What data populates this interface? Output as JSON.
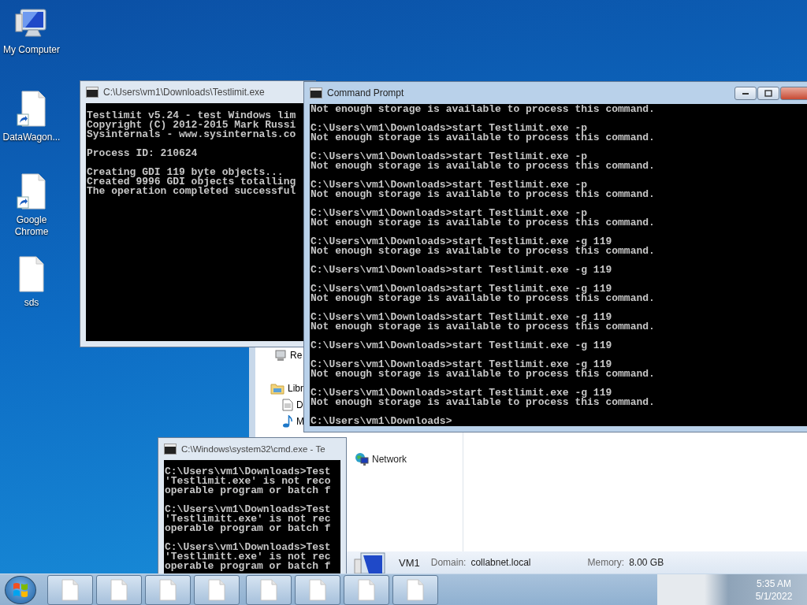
{
  "desktop_icons": [
    {
      "label": "My Computer",
      "kind": "computer"
    },
    {
      "label": "DataWagon...",
      "kind": "shortcut"
    },
    {
      "label": "Google Chrome",
      "kind": "shortcut"
    },
    {
      "label": "sds",
      "kind": "file"
    }
  ],
  "explorer_window": {
    "nav_items": [
      {
        "label": "Re",
        "kind": "device"
      },
      {
        "label": "Libr",
        "kind": "folder"
      },
      {
        "label": "D",
        "kind": "document"
      },
      {
        "label": "M",
        "kind": "music"
      },
      {
        "label": "Network",
        "kind": "network"
      }
    ],
    "details": {
      "name": "VM1",
      "fields": [
        {
          "label": "Domain:",
          "value": "collabnet.local"
        },
        {
          "label": "Memory:",
          "value": "8.00 GB"
        }
      ]
    }
  },
  "testlimit_window": {
    "title": "C:\\Users\\vm1\\Downloads\\Testlimit.exe",
    "active": false,
    "blocks": [
      [
        "Testlimit v5.24 - test Windows lim",
        "Copyright (C) 2012-2015 Mark Russi",
        "Sysinternals - www.sysinternals.co"
      ],
      [
        "Process ID: 210624"
      ],
      [
        "Creating GDI 119 byte objects...",
        "Created 9996 GDI objects totalling",
        "The operation completed successful"
      ]
    ]
  },
  "cmd_window": {
    "title": "C:\\Windows\\system32\\cmd.exe - Te",
    "active": false,
    "blocks": [
      [
        "C:\\Users\\vm1\\Downloads>Test",
        "'Testlimit.exe' is not reco",
        "operable program or batch f"
      ],
      [
        "C:\\Users\\vm1\\Downloads>Test",
        "'Testlimitt.exe' is not rec",
        "operable program or batch f"
      ],
      [
        "C:\\Users\\vm1\\Downloads>Test",
        "'Testlimitt.exe' is not rec",
        "operable program or batch f"
      ]
    ]
  },
  "command_prompt_window": {
    "title": "Command Prompt",
    "active": true,
    "blocks": [
      [
        "Not enough storage is available to process this command."
      ],
      [
        "C:\\Users\\vm1\\Downloads>start Testlimit.exe -p",
        "Not enough storage is available to process this command."
      ],
      [
        "C:\\Users\\vm1\\Downloads>start Testlimit.exe -p",
        "Not enough storage is available to process this command."
      ],
      [
        "C:\\Users\\vm1\\Downloads>start Testlimit.exe -p",
        "Not enough storage is available to process this command."
      ],
      [
        "C:\\Users\\vm1\\Downloads>start Testlimit.exe -p",
        "Not enough storage is available to process this command."
      ],
      [
        "C:\\Users\\vm1\\Downloads>start Testlimit.exe -g 119",
        "Not enough storage is available to process this command."
      ],
      [
        "C:\\Users\\vm1\\Downloads>start Testlimit.exe -g 119"
      ],
      [
        "C:\\Users\\vm1\\Downloads>start Testlimit.exe -g 119",
        "Not enough storage is available to process this command."
      ],
      [
        "C:\\Users\\vm1\\Downloads>start Testlimit.exe -g 119",
        "Not enough storage is available to process this command."
      ],
      [
        "C:\\Users\\vm1\\Downloads>start Testlimit.exe -g 119"
      ],
      [
        "C:\\Users\\vm1\\Downloads>start Testlimit.exe -g 119",
        "Not enough storage is available to process this command."
      ],
      [
        "C:\\Users\\vm1\\Downloads>start Testlimit.exe -g 119",
        "Not enough storage is available to process this command."
      ],
      [
        "C:\\Users\\vm1\\Downloads>"
      ]
    ]
  },
  "taskbar": {
    "button_groups": [
      [
        {
          "kind": "document"
        },
        {
          "kind": "document"
        },
        {
          "kind": "document"
        },
        {
          "kind": "document"
        }
      ],
      [
        {
          "kind": "document"
        },
        {
          "kind": "document"
        },
        {
          "kind": "document"
        },
        {
          "kind": "document"
        }
      ]
    ],
    "time": "5:35 AM",
    "date": "5/1/2022"
  }
}
